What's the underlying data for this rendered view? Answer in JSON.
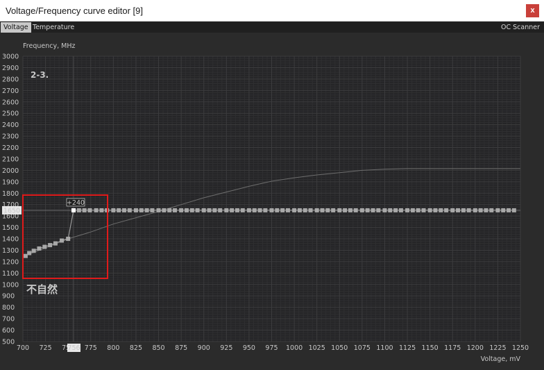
{
  "window": {
    "title": "Voltage/Frequency curve editor [9]",
    "close_label": "x"
  },
  "tabs": [
    {
      "label": "Voltage",
      "active": true
    },
    {
      "label": "Temperature",
      "active": false
    }
  ],
  "oc_scanner_label": "OC Scanner",
  "annotations": {
    "step_label": "2-3.",
    "region_label": "不自然",
    "offset_label": "+240",
    "current_freq_label": "1650",
    "current_volt_label": "756",
    "color": "#e01a1a"
  },
  "colors": {
    "background": "#2b2b2b",
    "plot_background": "#252527",
    "grid": "#3c3c3e",
    "default_curve": "#6e6e6e",
    "edited_curve": "#9a9a9a",
    "points": "#a8a8a8"
  },
  "chart_data": {
    "type": "line",
    "ylabel": "Frequency, MHz",
    "xlabel": "Voltage, mV",
    "xlim": [
      700,
      1250
    ],
    "ylim": [
      500,
      3000
    ],
    "x_ticks": [
      700,
      725,
      750,
      775,
      800,
      825,
      850,
      875,
      900,
      925,
      950,
      975,
      1000,
      1025,
      1050,
      1075,
      1100,
      1125,
      1150,
      1175,
      1200,
      1225,
      1250
    ],
    "y_ticks": [
      500,
      600,
      700,
      800,
      900,
      1000,
      1100,
      1200,
      1300,
      1400,
      1500,
      1600,
      1700,
      1800,
      1900,
      2000,
      2100,
      2200,
      2300,
      2400,
      2500,
      2600,
      2700,
      2800,
      2900,
      3000
    ],
    "grid": true,
    "series": [
      {
        "role": "default-curve",
        "x": [
          700,
          725,
          750,
          775,
          800,
          825,
          850,
          875,
          900,
          925,
          950,
          975,
          1000,
          1025,
          1050,
          1075,
          1100,
          1125,
          1150,
          1175,
          1200,
          1225,
          1250
        ],
        "y": [
          1245,
          1320,
          1400,
          1460,
          1530,
          1585,
          1640,
          1700,
          1760,
          1810,
          1860,
          1905,
          1935,
          1960,
          1980,
          2000,
          2010,
          2015,
          2015,
          2015,
          2015,
          2015,
          2015
        ]
      },
      {
        "role": "edited-curve",
        "x": [
          703,
          707,
          712,
          718,
          724,
          730,
          736,
          743,
          750,
          756,
          762,
          768,
          774,
          781,
          787,
          793,
          800,
          806,
          812,
          818,
          825,
          831,
          837,
          843,
          850,
          856,
          862,
          868,
          875,
          881,
          887,
          893,
          900,
          906,
          912,
          918,
          925,
          931,
          937,
          943,
          950,
          956,
          962,
          968,
          975,
          981,
          987,
          993,
          1000,
          1006,
          1012,
          1018,
          1025,
          1031,
          1037,
          1043,
          1050,
          1056,
          1062,
          1068,
          1075,
          1081,
          1087,
          1093,
          1100,
          1106,
          1112,
          1118,
          1125,
          1131,
          1137,
          1143,
          1150,
          1156,
          1162,
          1168,
          1175,
          1181,
          1187,
          1193,
          1200,
          1206,
          1212,
          1218,
          1225,
          1231,
          1237,
          1243
        ],
        "y": [
          1250,
          1275,
          1295,
          1315,
          1330,
          1345,
          1360,
          1385,
          1400,
          1650,
          1650,
          1650,
          1650,
          1650,
          1650,
          1650,
          1650,
          1650,
          1650,
          1650,
          1650,
          1650,
          1650,
          1650,
          1650,
          1650,
          1650,
          1650,
          1650,
          1650,
          1650,
          1650,
          1650,
          1650,
          1650,
          1650,
          1650,
          1650,
          1650,
          1650,
          1650,
          1650,
          1650,
          1650,
          1650,
          1650,
          1650,
          1650,
          1650,
          1650,
          1650,
          1650,
          1650,
          1650,
          1650,
          1650,
          1650,
          1650,
          1650,
          1650,
          1650,
          1650,
          1650,
          1650,
          1650,
          1650,
          1650,
          1650,
          1650,
          1650,
          1650,
          1650,
          1650,
          1650,
          1650,
          1650,
          1650,
          1650,
          1650,
          1650,
          1650,
          1650,
          1650,
          1650,
          1650,
          1650,
          1650,
          1650
        ]
      }
    ],
    "selected_point": {
      "x": 756,
      "y": 1650
    }
  }
}
